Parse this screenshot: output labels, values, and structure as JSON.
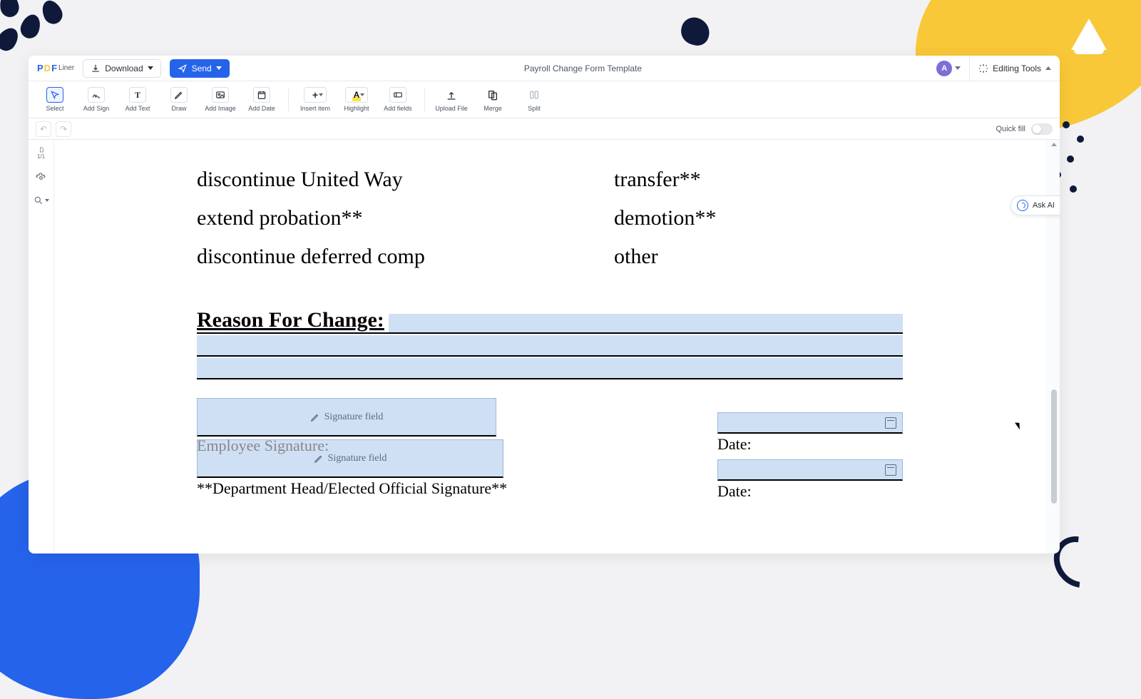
{
  "header": {
    "logo_parts": [
      "P",
      "D",
      "F",
      "Liner"
    ],
    "download_label": "Download",
    "send_label": "Send",
    "document_title": "Payroll Change Form Template",
    "avatar_letter": "A",
    "editing_tools_label": "Editing Tools"
  },
  "toolbar": {
    "select": "Select",
    "add_sign": "Add Sign",
    "add_text": "Add Text",
    "draw": "Draw",
    "add_image": "Add Image",
    "add_date": "Add Date",
    "insert_item": "Insert item",
    "highlight": "Highlight",
    "add_fields": "Add fields",
    "upload_file": "Upload File",
    "merge": "Merge",
    "split": "Split"
  },
  "subbar": {
    "quick_fill_label": "Quick fill"
  },
  "left_rail": {
    "page_indicator": "1/1"
  },
  "ask_ai_label": "Ask AI",
  "document": {
    "options_left": [
      "discontinue United Way",
      "extend probation**",
      "discontinue deferred comp"
    ],
    "options_right": [
      "transfer**",
      "demotion**",
      "other"
    ],
    "reason_heading": "Reason For Change:",
    "signature_field_label": "Signature field",
    "employee_signature_label": "Employee Signature:",
    "dept_signature_label": "**Department Head/Elected Official Signature**",
    "date_label_1": "Date:",
    "date_label_2": "Date:"
  }
}
